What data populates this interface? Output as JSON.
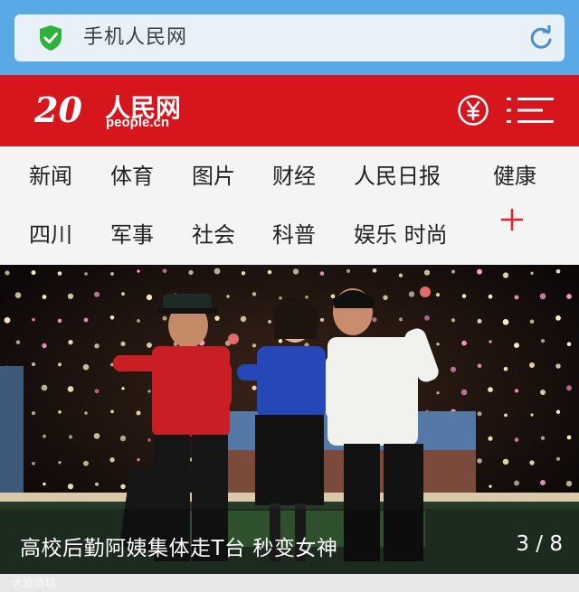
{
  "browser": {
    "url_title": "手机人民网",
    "security_icon": "shield-check-icon",
    "reload_icon": "reload-icon"
  },
  "header": {
    "logo_text": "人民网",
    "logo_number": "20",
    "logo_sub": "people.cn",
    "brand_color": "#d7151c",
    "currency_icon": "yuan-icon",
    "menu_icon": "hamburger-menu-icon"
  },
  "nav": {
    "row1": [
      "新闻",
      "体育",
      "图片",
      "财经",
      "人民日报",
      "健康"
    ],
    "row2": [
      "四川",
      "军事",
      "社会",
      "科普",
      "娱乐 时尚"
    ],
    "more_icon": "plus-icon"
  },
  "hero": {
    "caption": "高校后勤阿姨集体走T台 秒变女神",
    "counter": "3 / 8"
  },
  "watermark": "大欧商城"
}
